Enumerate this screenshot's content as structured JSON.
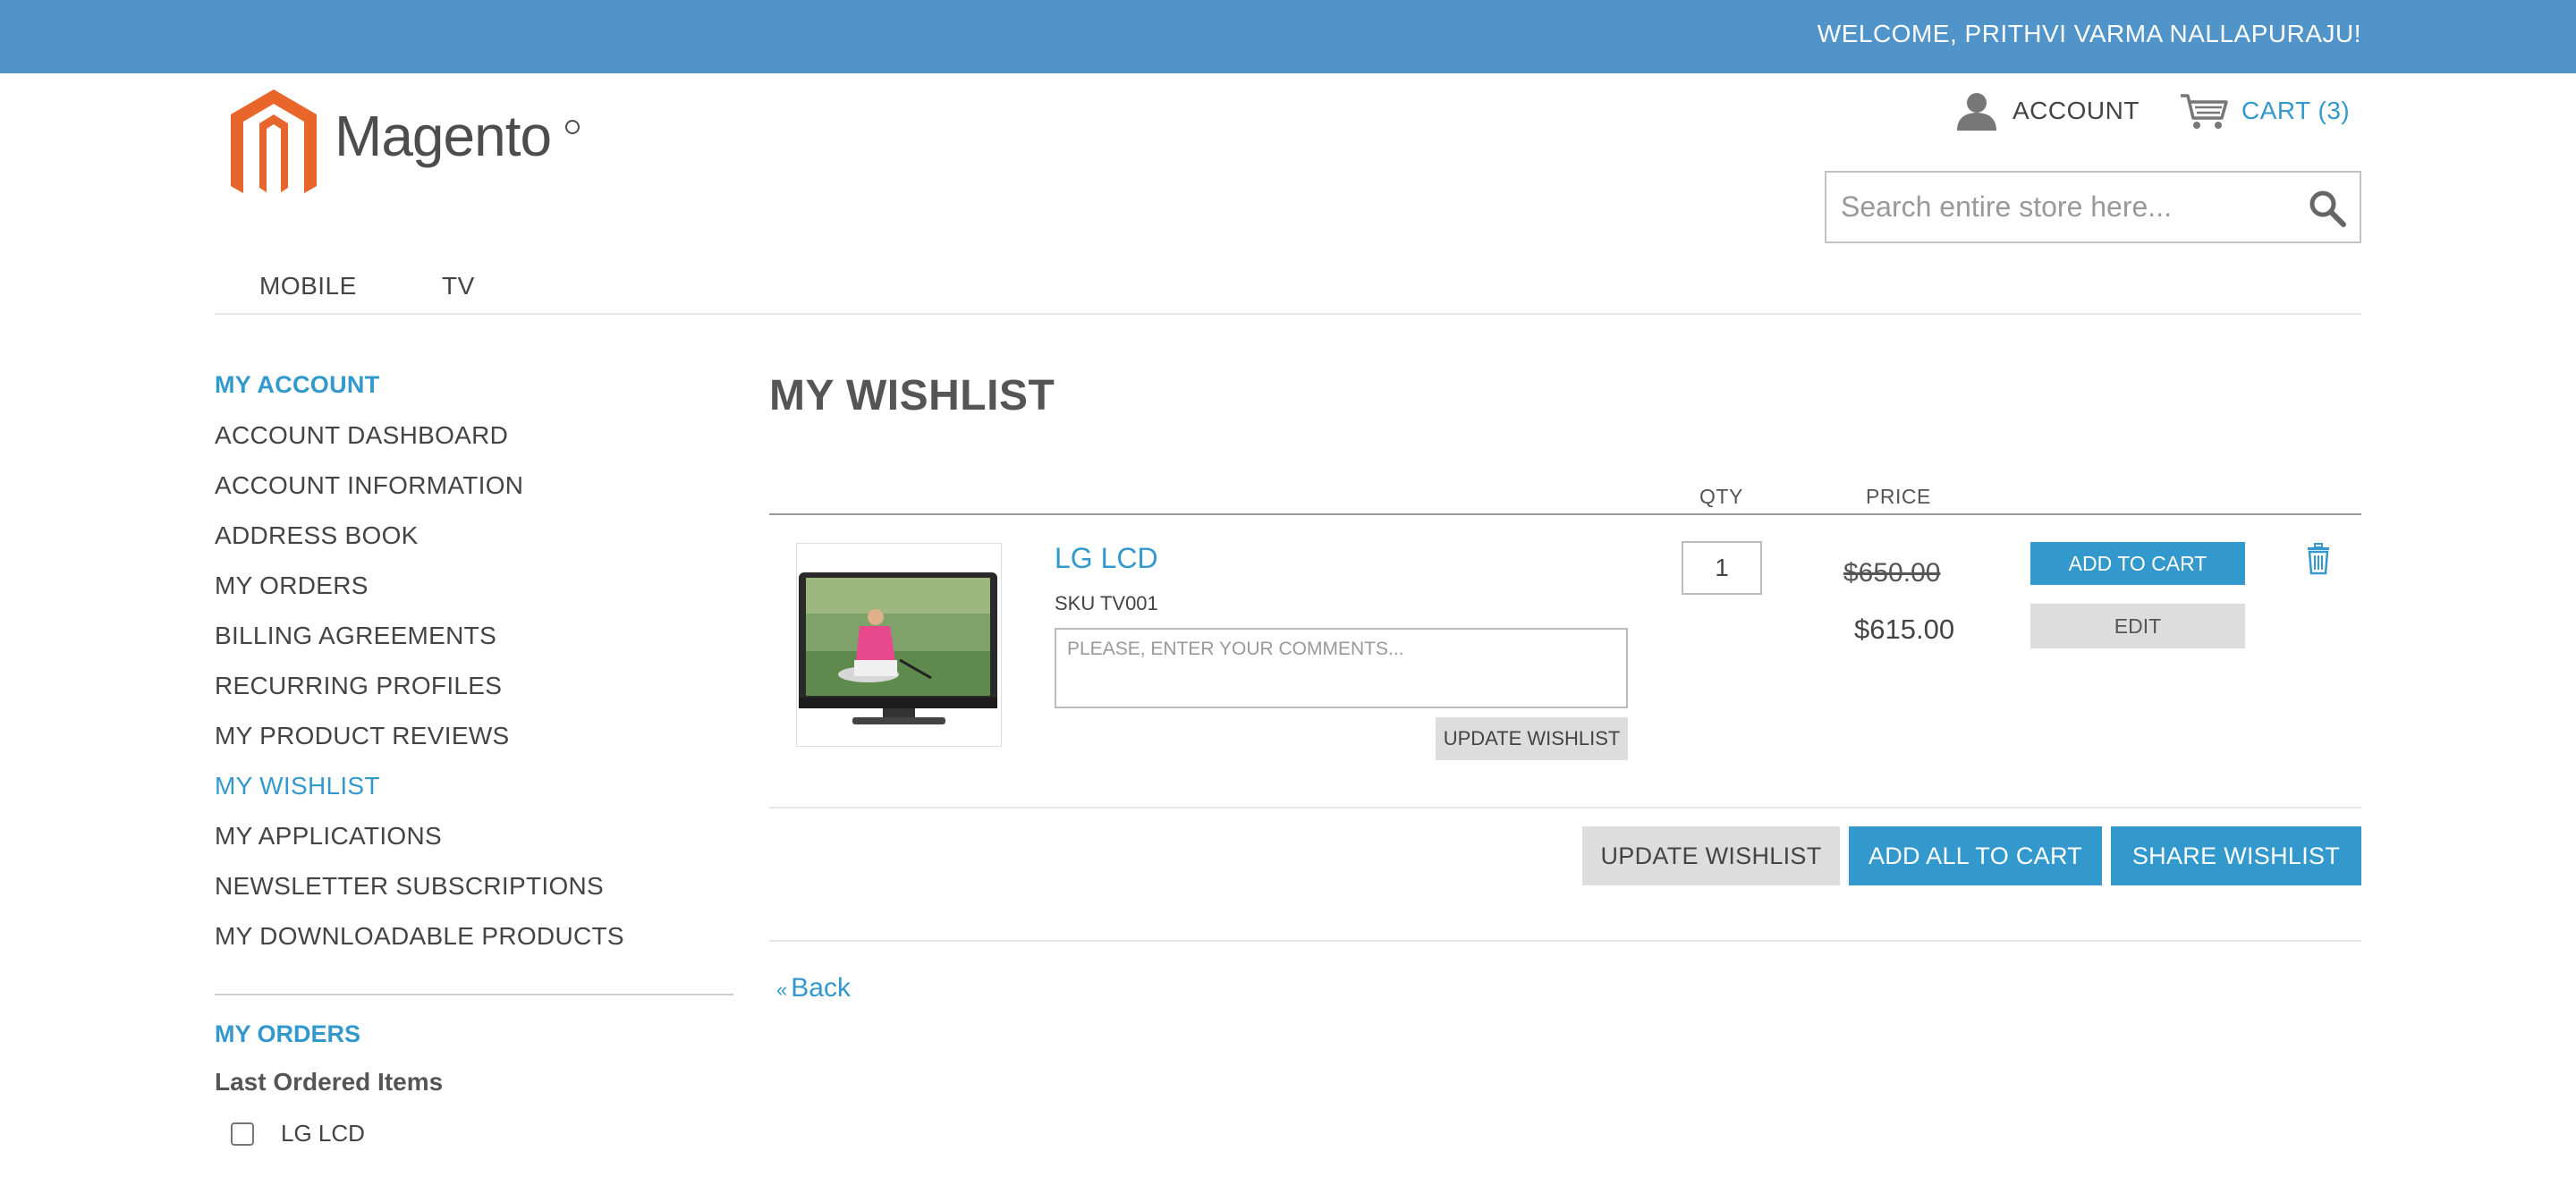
{
  "header": {
    "welcome": "WELCOME, PRITHVI VARMA NALLAPURAJU!",
    "logo_text": "Magento",
    "account_label": "ACCOUNT",
    "cart_label": "CART (3)",
    "search_placeholder": "Search entire store here..."
  },
  "nav": {
    "items": [
      "MOBILE",
      "TV"
    ]
  },
  "sidebar": {
    "title": "MY ACCOUNT",
    "items": [
      "ACCOUNT DASHBOARD",
      "ACCOUNT INFORMATION",
      "ADDRESS BOOK",
      "MY ORDERS",
      "BILLING AGREEMENTS",
      "RECURRING PROFILES",
      "MY PRODUCT REVIEWS",
      "MY WISHLIST",
      "MY APPLICATIONS",
      "NEWSLETTER SUBSCRIPTIONS",
      "MY DOWNLOADABLE PRODUCTS"
    ],
    "active_item": "MY WISHLIST",
    "orders_title": "MY ORDERS",
    "last_ordered_title": "Last Ordered Items",
    "last_ordered_items": [
      "LG LCD"
    ]
  },
  "main": {
    "title": "MY WISHLIST",
    "columns": {
      "qty": "QTY",
      "price": "PRICE"
    },
    "item": {
      "name": "LG LCD",
      "sku": "SKU TV001",
      "comment_placeholder": "PLEASE, ENTER YOUR COMMENTS...",
      "qty": "1",
      "old_price": "$650.00",
      "price": "$615.00",
      "add_to_cart": "ADD TO CART",
      "edit": "EDIT",
      "update_wishlist": "UPDATE WISHLIST"
    },
    "actions": {
      "update_wishlist": "UPDATE WISHLIST",
      "add_all_to_cart": "ADD ALL TO CART",
      "share_wishlist": "SHARE WISHLIST"
    },
    "back_label": "Back",
    "back_prefix": "«"
  },
  "colors": {
    "topbar": "#5094c9",
    "accent": "#3399cc",
    "logo_orange": "#e6662e",
    "button_gray": "#dddddd"
  }
}
